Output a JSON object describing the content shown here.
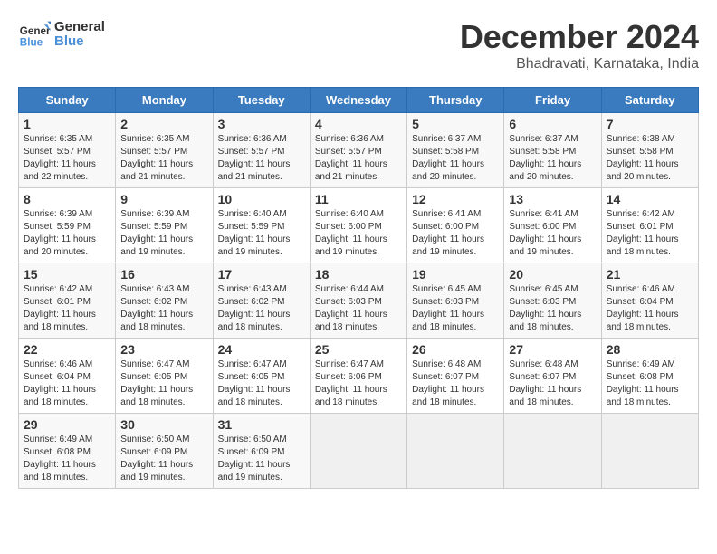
{
  "logo": {
    "line1": "General",
    "line2": "Blue"
  },
  "title": "December 2024",
  "subtitle": "Bhadravati, Karnataka, India",
  "headers": [
    "Sunday",
    "Monday",
    "Tuesday",
    "Wednesday",
    "Thursday",
    "Friday",
    "Saturday"
  ],
  "weeks": [
    [
      {
        "day": "1",
        "sunrise": "6:35 AM",
        "sunset": "5:57 PM",
        "daylight": "11 hours and 22 minutes."
      },
      {
        "day": "2",
        "sunrise": "6:35 AM",
        "sunset": "5:57 PM",
        "daylight": "11 hours and 21 minutes."
      },
      {
        "day": "3",
        "sunrise": "6:36 AM",
        "sunset": "5:57 PM",
        "daylight": "11 hours and 21 minutes."
      },
      {
        "day": "4",
        "sunrise": "6:36 AM",
        "sunset": "5:57 PM",
        "daylight": "11 hours and 21 minutes."
      },
      {
        "day": "5",
        "sunrise": "6:37 AM",
        "sunset": "5:58 PM",
        "daylight": "11 hours and 20 minutes."
      },
      {
        "day": "6",
        "sunrise": "6:37 AM",
        "sunset": "5:58 PM",
        "daylight": "11 hours and 20 minutes."
      },
      {
        "day": "7",
        "sunrise": "6:38 AM",
        "sunset": "5:58 PM",
        "daylight": "11 hours and 20 minutes."
      }
    ],
    [
      {
        "day": "8",
        "sunrise": "6:39 AM",
        "sunset": "5:59 PM",
        "daylight": "11 hours and 20 minutes."
      },
      {
        "day": "9",
        "sunrise": "6:39 AM",
        "sunset": "5:59 PM",
        "daylight": "11 hours and 19 minutes."
      },
      {
        "day": "10",
        "sunrise": "6:40 AM",
        "sunset": "5:59 PM",
        "daylight": "11 hours and 19 minutes."
      },
      {
        "day": "11",
        "sunrise": "6:40 AM",
        "sunset": "6:00 PM",
        "daylight": "11 hours and 19 minutes."
      },
      {
        "day": "12",
        "sunrise": "6:41 AM",
        "sunset": "6:00 PM",
        "daylight": "11 hours and 19 minutes."
      },
      {
        "day": "13",
        "sunrise": "6:41 AM",
        "sunset": "6:00 PM",
        "daylight": "11 hours and 19 minutes."
      },
      {
        "day": "14",
        "sunrise": "6:42 AM",
        "sunset": "6:01 PM",
        "daylight": "11 hours and 18 minutes."
      }
    ],
    [
      {
        "day": "15",
        "sunrise": "6:42 AM",
        "sunset": "6:01 PM",
        "daylight": "11 hours and 18 minutes."
      },
      {
        "day": "16",
        "sunrise": "6:43 AM",
        "sunset": "6:02 PM",
        "daylight": "11 hours and 18 minutes."
      },
      {
        "day": "17",
        "sunrise": "6:43 AM",
        "sunset": "6:02 PM",
        "daylight": "11 hours and 18 minutes."
      },
      {
        "day": "18",
        "sunrise": "6:44 AM",
        "sunset": "6:03 PM",
        "daylight": "11 hours and 18 minutes."
      },
      {
        "day": "19",
        "sunrise": "6:45 AM",
        "sunset": "6:03 PM",
        "daylight": "11 hours and 18 minutes."
      },
      {
        "day": "20",
        "sunrise": "6:45 AM",
        "sunset": "6:03 PM",
        "daylight": "11 hours and 18 minutes."
      },
      {
        "day": "21",
        "sunrise": "6:46 AM",
        "sunset": "6:04 PM",
        "daylight": "11 hours and 18 minutes."
      }
    ],
    [
      {
        "day": "22",
        "sunrise": "6:46 AM",
        "sunset": "6:04 PM",
        "daylight": "11 hours and 18 minutes."
      },
      {
        "day": "23",
        "sunrise": "6:47 AM",
        "sunset": "6:05 PM",
        "daylight": "11 hours and 18 minutes."
      },
      {
        "day": "24",
        "sunrise": "6:47 AM",
        "sunset": "6:05 PM",
        "daylight": "11 hours and 18 minutes."
      },
      {
        "day": "25",
        "sunrise": "6:47 AM",
        "sunset": "6:06 PM",
        "daylight": "11 hours and 18 minutes."
      },
      {
        "day": "26",
        "sunrise": "6:48 AM",
        "sunset": "6:07 PM",
        "daylight": "11 hours and 18 minutes."
      },
      {
        "day": "27",
        "sunrise": "6:48 AM",
        "sunset": "6:07 PM",
        "daylight": "11 hours and 18 minutes."
      },
      {
        "day": "28",
        "sunrise": "6:49 AM",
        "sunset": "6:08 PM",
        "daylight": "11 hours and 18 minutes."
      }
    ],
    [
      {
        "day": "29",
        "sunrise": "6:49 AM",
        "sunset": "6:08 PM",
        "daylight": "11 hours and 18 minutes."
      },
      {
        "day": "30",
        "sunrise": "6:50 AM",
        "sunset": "6:09 PM",
        "daylight": "11 hours and 19 minutes."
      },
      {
        "day": "31",
        "sunrise": "6:50 AM",
        "sunset": "6:09 PM",
        "daylight": "11 hours and 19 minutes."
      },
      null,
      null,
      null,
      null
    ]
  ]
}
